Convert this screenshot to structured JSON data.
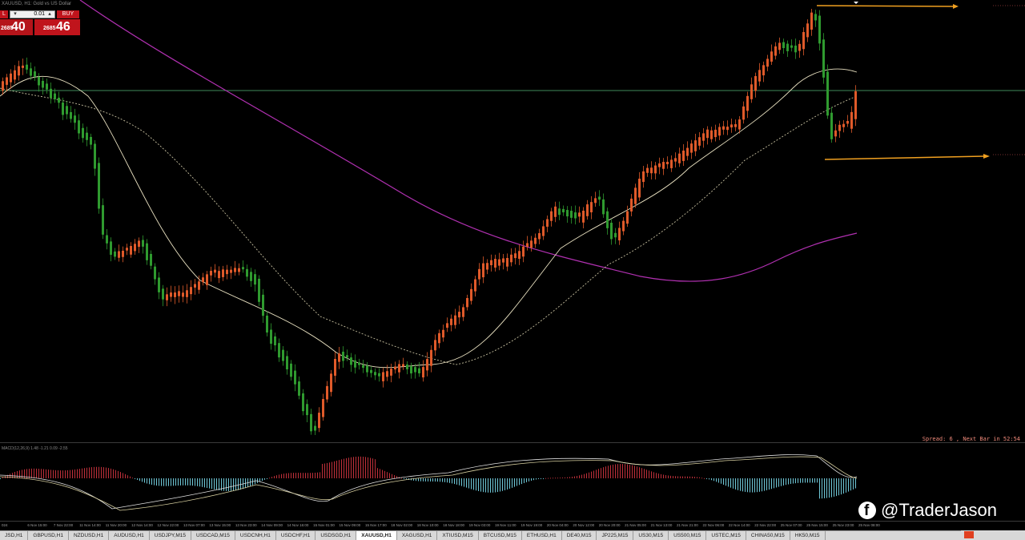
{
  "panel": {
    "title": "XAUUSD, H1: Gold vs US Dollar",
    "sell_label": "L",
    "buy_label": "BUY",
    "lot_value": "0.01",
    "sell_price_small": "2685",
    "sell_price_big": "40",
    "buy_price_small": "2685",
    "buy_price_big": "46"
  },
  "status": {
    "spread_text": "Spread: 6 , Next Bar in 52:54"
  },
  "osc_label": "MACD(12,26,9) 1.48 -1.21 0.09 -2.55",
  "time_axis": [
    "024",
    "6 Nov 15:00",
    "7 Nov 22:00",
    "11 Nov 14:00",
    "11 Nov 20:00",
    "12 Nov 14:00",
    "12 Nov 22:00",
    "13 Nov 07:00",
    "13 Nov 15:00",
    "13 Nov 23:00",
    "14 Nov 09:00",
    "14 Nov 16:00",
    "15 Nov 01:00",
    "15 Nov 09:00",
    "15 Nov 17:00",
    "18 Nov 02:00",
    "18 Nov 10:00",
    "18 Nov 18:00",
    "19 Nov 03:00",
    "19 Nov 11:00",
    "19 Nov 19:00",
    "20 Nov 04:00",
    "20 Nov 12:00",
    "20 Nov 20:00",
    "21 Nov 05:00",
    "21 Nov 13:00",
    "21 Nov 21:00",
    "22 Nov 06:00",
    "22 Nov 14:00",
    "22 Nov 22:00",
    "25 Nov 07:00",
    "25 Nov 15:00",
    "25 Nov 23:00",
    "25 Nov 08:00"
  ],
  "tabs": [
    "JSD,H1",
    "GBPUSD,H1",
    "NZDUSD,H1",
    "AUDUSD,H1",
    "USDJPY,M15",
    "USDCAD,M15",
    "USDCNH,H1",
    "USDCHF,H1",
    "USDSGD,H1",
    "XAUUSD,H1",
    "XAGUSD,H1",
    "XTIUSD,M15",
    "BTCUSD,M15",
    "ETHUSD,H1",
    "DE40,M15",
    "JP225,M15",
    "US30,M15",
    "US500,M15",
    "USTEC,M15",
    "CHINA50,M15",
    "HK50,M15"
  ],
  "active_tab": "XAUUSD,H1",
  "watermark": "@TraderJason",
  "colors": {
    "bull": "#e05a2a",
    "bear": "#2f9a2f",
    "ma_fast": "#e8e0c0",
    "ma_slow": "#c7c0a0",
    "ma_long": "#b030b0",
    "arrow": "#f0a020",
    "hist_pos": "#c0303a",
    "hist_neg": "#70c8d8"
  }
}
